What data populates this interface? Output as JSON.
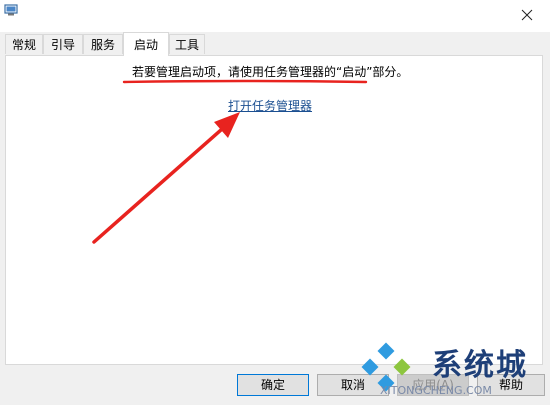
{
  "tabs": [
    {
      "label": "常规"
    },
    {
      "label": "引导"
    },
    {
      "label": "服务"
    },
    {
      "label": "启动"
    },
    {
      "label": "工具"
    }
  ],
  "startup_panel": {
    "info_text": "若要管理启动项，请使用任务管理器的“启动”部分。",
    "link_text": "打开任务管理器"
  },
  "buttons": {
    "ok": "确定",
    "cancel": "取消",
    "apply": "应用(A)",
    "help": "帮助"
  },
  "watermark": {
    "brand": "系统城",
    "site": "XITONGCHENG.COM"
  },
  "colors": {
    "annotation": "#e8231f",
    "link": "#1b4f91",
    "accent": "#0078d7"
  }
}
